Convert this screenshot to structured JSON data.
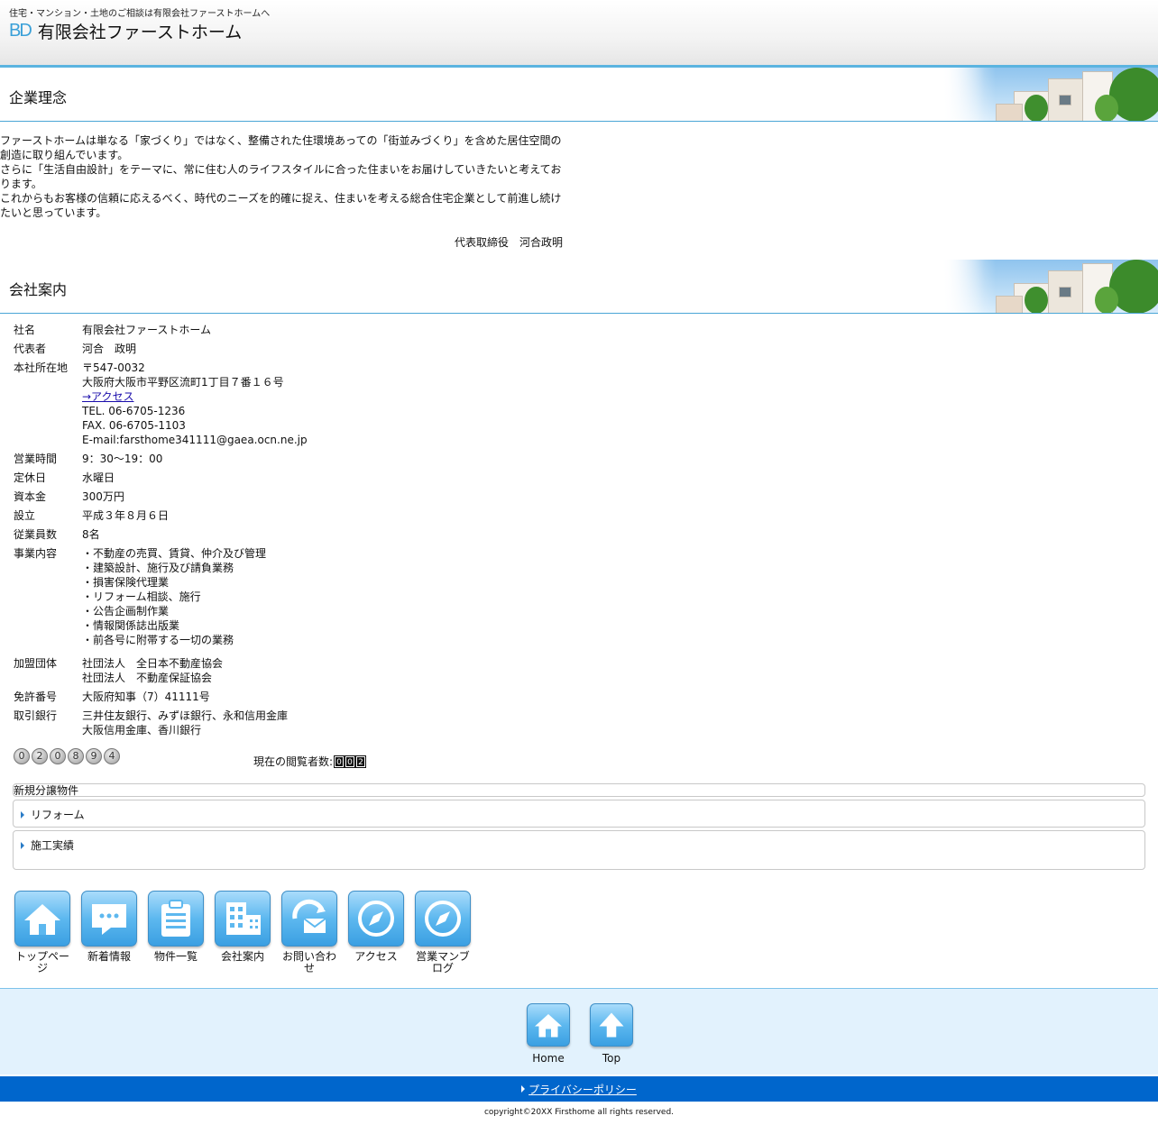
{
  "header": {
    "tagline": "住宅・マンション・土地のご相談は有限会社ファーストホームへ",
    "logo_mark": "BD",
    "company_name": "有限会社ファーストホーム"
  },
  "philosophy": {
    "title": "企業理念",
    "lines": [
      "ファーストホームは単なる「家づくり」ではなく、整備された住環境あっての「街並みづくり」を含めた居住空間の",
      "創造に取り組んでいます。",
      "さらに「生活自由設計」をテーマに、常に住む人のライフスタイルに合った住まいをお届けしていきたいと考えてお",
      "ります。",
      "これからもお客様の信頼に応えるべく、時代のニーズを的確に捉え、住まいを考える総合住宅企業として前進し続け",
      "たいと思っています。"
    ],
    "signature": "代表取締役　河合政明"
  },
  "company": {
    "title": "会社案内",
    "rows": [
      {
        "key": "社名",
        "lines": [
          "有限会社ファーストホーム"
        ]
      },
      {
        "key": "代表者",
        "lines": [
          "河合　政明"
        ]
      },
      {
        "key": "本社所在地",
        "lines": [
          "〒547-0032",
          "大阪府大阪市平野区流町1丁目７番１６号",
          "→アクセス",
          "TEL. 06-6705-1236",
          "FAX. 06-6705-1103",
          "E-mail:farsthome341111@gaea.ocn.ne.jp"
        ]
      },
      {
        "key": "営業時間",
        "lines": [
          "9：30～19：00"
        ]
      },
      {
        "key": "定休日",
        "lines": [
          "水曜日"
        ]
      },
      {
        "key": "資本金",
        "lines": [
          "300万円"
        ]
      },
      {
        "key": "設立",
        "lines": [
          "平成３年８月６日"
        ]
      },
      {
        "key": "従業員数",
        "lines": [
          "8名"
        ]
      },
      {
        "key": "事業内容",
        "lines": [
          "・不動産の売買、賃貸、仲介及び管理",
          "・建築設計、施行及び請負業務",
          "・損害保険代理業",
          "・リフォーム相談、施行",
          "・公告企画制作業",
          "・情報関係誌出版業",
          "・前各号に附帯する一切の業務"
        ]
      },
      {
        "key": "加盟団体",
        "lines": [
          "社団法人　全日本不動産協会",
          "社団法人　不動産保証協会"
        ]
      },
      {
        "key": "免許番号",
        "lines": [
          "大阪府知事（7）41111号"
        ]
      },
      {
        "key": "取引銀行",
        "lines": [
          "三井住友銀行、みずほ銀行、永和信用金庫",
          "大阪信用金庫、香川銀行"
        ]
      }
    ]
  },
  "counter": {
    "digits": [
      "0",
      "2",
      "0",
      "8",
      "9",
      "4"
    ],
    "viewers_label": "現在の閲覧者数:",
    "viewers_digits": [
      "0",
      "0",
      "2"
    ]
  },
  "menu": {
    "new_sales": "新規分譲物件",
    "reform": "リフォーム",
    "works": "施工実績"
  },
  "iconnav": [
    {
      "label": "トップページ",
      "icon": "home-icon"
    },
    {
      "label": "新着情報",
      "icon": "speech-bubble-icon"
    },
    {
      "label": "物件一覧",
      "icon": "clipboard-icon"
    },
    {
      "label": "会社案内",
      "icon": "building-icon"
    },
    {
      "label": "お問い合わせ",
      "icon": "mail-icon"
    },
    {
      "label": "アクセス",
      "icon": "compass-icon"
    },
    {
      "label": "営業マンブログ",
      "icon": "compass-icon"
    }
  ],
  "footer": {
    "home_label": "Home",
    "top_label": "Top",
    "privacy": "プライバシーポリシー",
    "copyright": "copyright©20XX Firsthome all rights reserved."
  },
  "colors": {
    "accent": "#4aa6d6",
    "privacy_bar": "#0066cc",
    "footer_band": "#e2f2fd",
    "tile_blue": "#5db8ef"
  }
}
